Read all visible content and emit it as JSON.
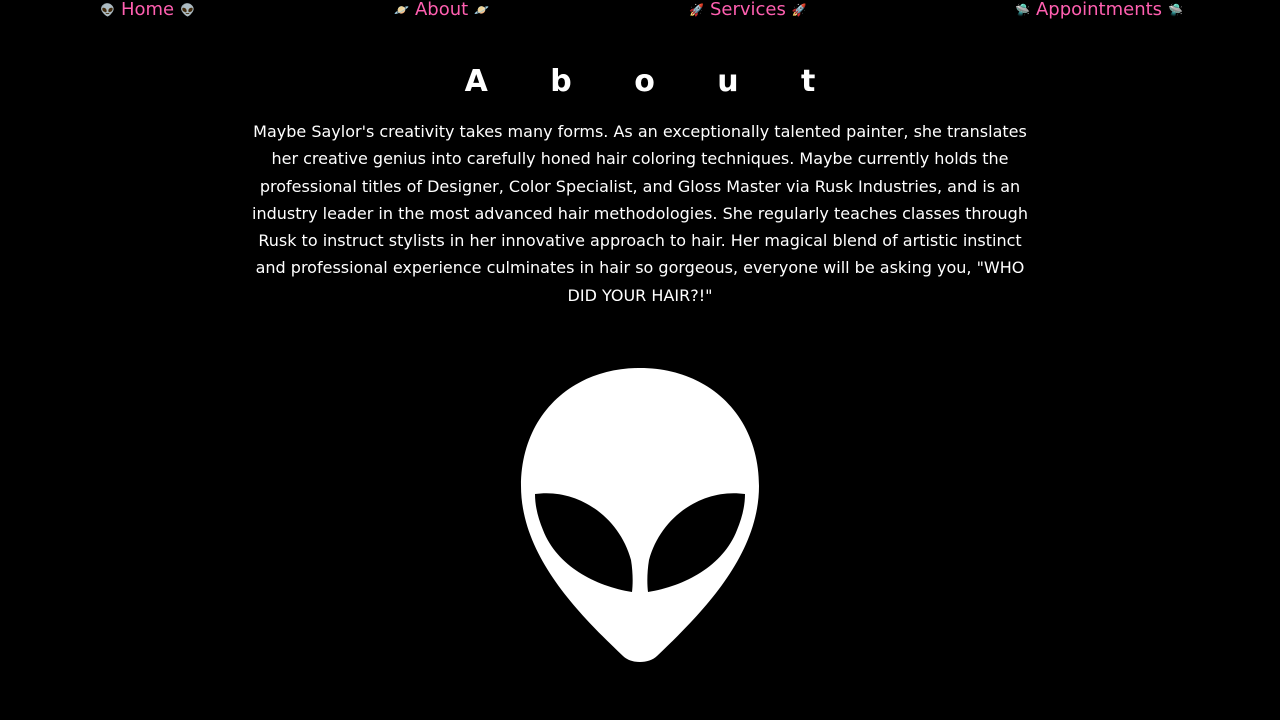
{
  "nav": {
    "home": {
      "label": "Home",
      "emoji_left": "👽",
      "emoji_right": "👽"
    },
    "about": {
      "label": "About",
      "emoji_left": "🪐",
      "emoji_right": "🪐"
    },
    "services": {
      "label": "Services",
      "emoji_left": "🚀",
      "emoji_right": "🚀"
    },
    "appointments": {
      "label": "Appointments",
      "emoji_left": "🛸",
      "emoji_right": "🛸"
    },
    "link_color": "#ff5fb0"
  },
  "page": {
    "title": "A b o u t",
    "body": "Maybe Saylor's creativity takes many forms. As an exceptionally talented painter, she translates her creative genius into carefully honed hair coloring techniques. Maybe currently holds the professional titles of Designer, Color Specialist, and Gloss Master via Rusk Industries, and is an industry leader in the most advanced hair methodologies. She regularly teaches classes through Rusk to instruct stylists in her innovative approach to hair. Her magical blend of artistic instinct and professional experience culminates in hair so gorgeous, everyone will be asking you, \"WHO DID YOUR HAIR?!\""
  },
  "alien_graphic": {
    "icon": "alien-head-icon",
    "fill": "#ffffff",
    "eye_color": "#000000"
  },
  "background": "#000000"
}
